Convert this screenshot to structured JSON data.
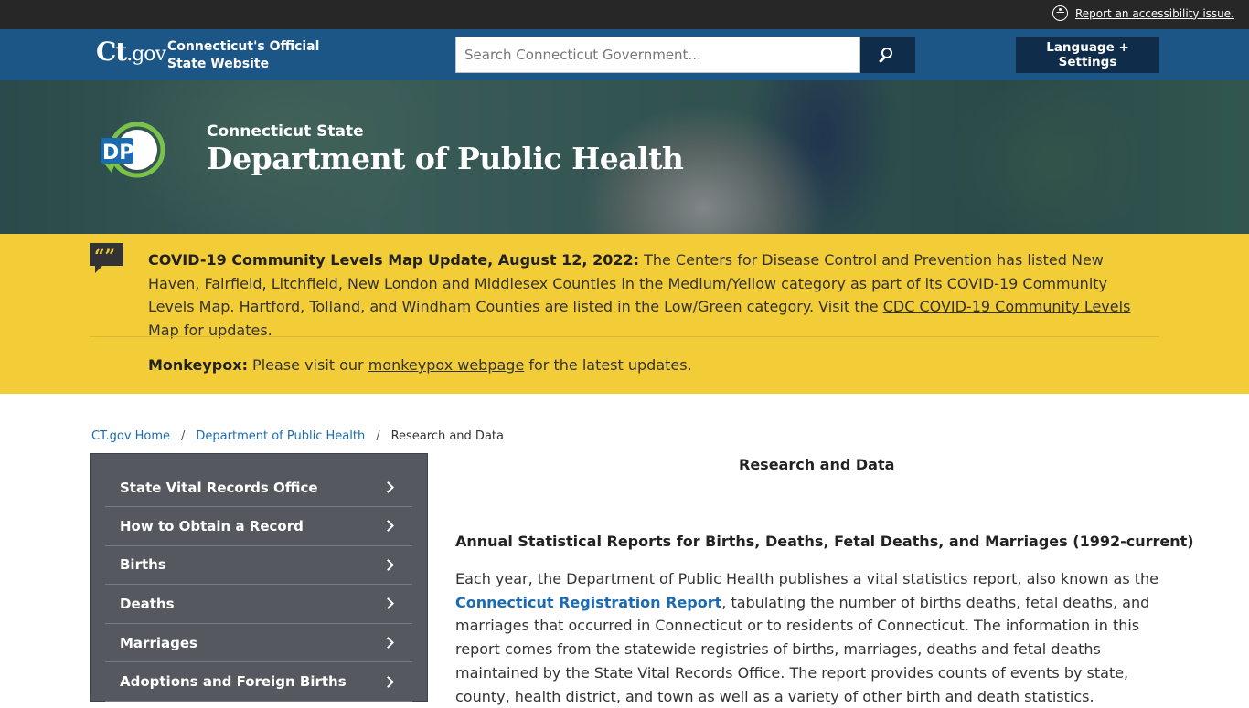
{
  "util": {
    "accessibility_link": "Report an accessibility issue."
  },
  "header": {
    "logo_ct": "Ct",
    "logo_gov": ".gov",
    "tagline_1": "Connecticut's Official",
    "tagline_2": "State Website",
    "search_placeholder": "Search Connecticut Government...",
    "language_button": "Language + Settings"
  },
  "hero": {
    "subtitle": "Connecticut State",
    "title": "Department of Public Health",
    "logo_text": "DPH"
  },
  "alert": {
    "covid_heading": "COVID-19 Community Levels Map Update, August 12, 2022:",
    "covid_text": " The Centers for Disease Control and Prevention has listed New Haven, Fairfield, Litchfield, New London and Middlesex Counties in the Medium/Yellow category as part of its COVID-19 Community Levels Map. Hartford, Tolland, and Windham Counties are listed in the Low/Green category. Visit the ",
    "covid_link": "CDC COVID-19 Community Levels Map",
    "covid_tail": " for updates.",
    "monkeypox_heading": "Monkeypox:",
    "monkeypox_text": " Please visit our ",
    "monkeypox_link": "monkeypox webpage",
    "monkeypox_tail": " for the latest updates."
  },
  "breadcrumb": {
    "home": "CT.gov Home",
    "dept": "Department of Public Health",
    "current": "Research and Data",
    "separator": "/"
  },
  "sidebar": {
    "items": [
      {
        "label": "State Vital Records Office"
      },
      {
        "label": "How to Obtain a Record"
      },
      {
        "label": "Births"
      },
      {
        "label": "Deaths"
      },
      {
        "label": "Marriages"
      },
      {
        "label": "Adoptions and Foreign Births"
      }
    ]
  },
  "main": {
    "title": "Research and Data",
    "section_heading": "Annual Statistical Reports for Births, Deaths, Fetal Deaths, and Marriages (1992-current)",
    "para_intro": "Each year, the Department of Public Health publishes a vital statistics report, also known as the ",
    "para_link": "Connecticut Registration Report",
    "para_rest": ", tabulating the number of births deaths, fetal deaths, and marriages that occurred in Connecticut or to residents of Connecticut.  The information in this report comes from the statewide registries of births, marriages, deaths and fetal deaths maintained by the State Vital Records Office. The report provides counts of events by state, county, health district, and town as well as a variety of other birth and death statistics."
  },
  "colors": {
    "header_blue": "#1c5687",
    "dark_navy": "#0f2d4a",
    "alert_yellow": "#f2cd38",
    "sidebar_gray": "#55585e",
    "link_blue": "#1c6bb0"
  }
}
